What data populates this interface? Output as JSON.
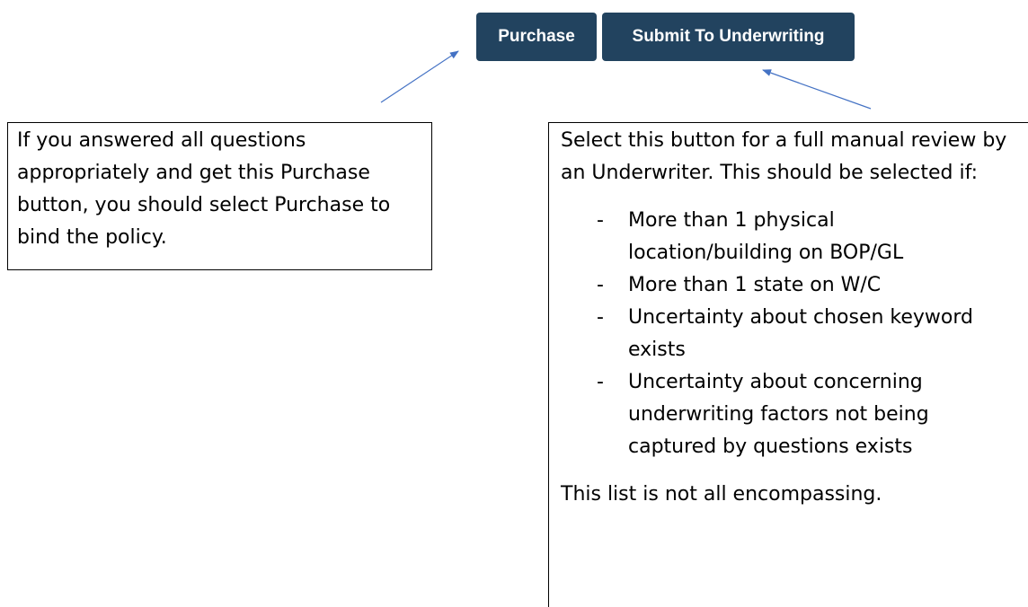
{
  "buttons": {
    "purchase_label": "Purchase",
    "submit_label": "Submit To Underwriting",
    "color": "#22435f"
  },
  "notes": {
    "purchase": {
      "text": "If you answered all questions appropriately and get this Purchase button, you should select Purchase to bind the policy."
    },
    "underwriting": {
      "intro": "Select this button for a full manual review by an Underwriter. This should be selected if:",
      "bullets": [
        "More than 1 physical location/building on BOP/GL",
        "More than 1 state on W/C",
        "Uncertainty about chosen keyword exists",
        "Uncertainty about concerning underwriting factors not being captured by questions exists"
      ],
      "bullet_marker": "-",
      "footer": "This list is not all encompassing."
    }
  },
  "arrow_color": "#4472c4"
}
